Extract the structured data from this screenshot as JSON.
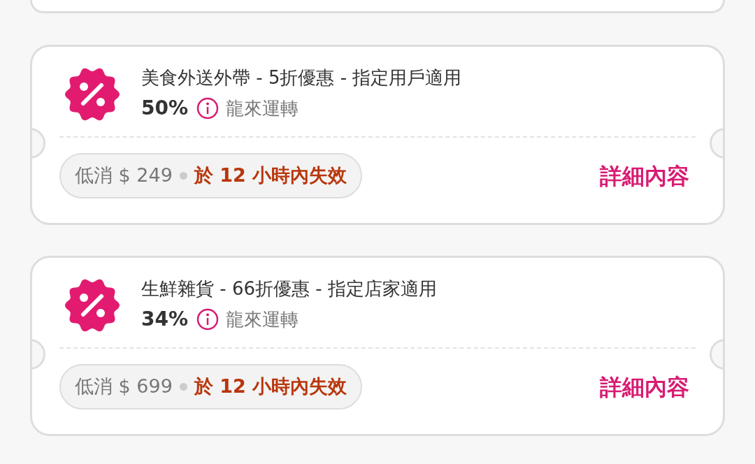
{
  "coupons": [
    {
      "title": "美食外送外帶 - 5折優惠 - 指定用戶適用",
      "percent": "50%",
      "merchant": "龍來運轉",
      "min_spend": "低消 $ 249",
      "expiry": "於 12 小時內失效",
      "link": "詳細內容"
    },
    {
      "title": "生鮮雜貨 - 66折優惠 - 指定店家適用",
      "percent": "34%",
      "merchant": "龍來運轉",
      "min_spend": "低消 $ 699",
      "expiry": "於 12 小時內失效",
      "link": "詳細內容"
    }
  ]
}
